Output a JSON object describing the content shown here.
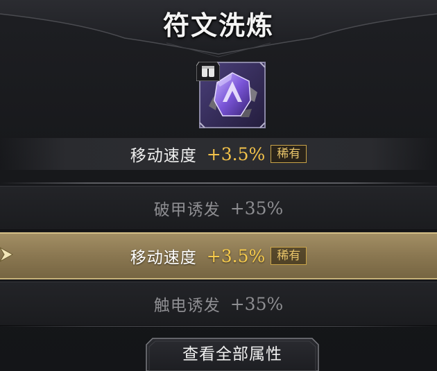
{
  "header": {
    "title": "符文洗炼"
  },
  "rune": {
    "icon": "purple-rune-crystal-icon",
    "badge_icon": "armor-badge-icon"
  },
  "current_stat": {
    "name": "移动速度",
    "value": "+3.5%",
    "rarity": "稀有"
  },
  "options": [
    {
      "name": "破甲诱发",
      "value": "+35%"
    },
    {
      "name": "移动速度",
      "value": "+3.5%",
      "rarity": "稀有",
      "selected": true
    },
    {
      "name": "触电诱发",
      "value": "+35%"
    }
  ],
  "view_all_button": {
    "label": "查看全部属性"
  },
  "colors": {
    "gold_value": "#f3c24a",
    "rarity_border": "#c9a448",
    "selected_row": "#8a7751",
    "dim_text": "#8e8e92"
  }
}
